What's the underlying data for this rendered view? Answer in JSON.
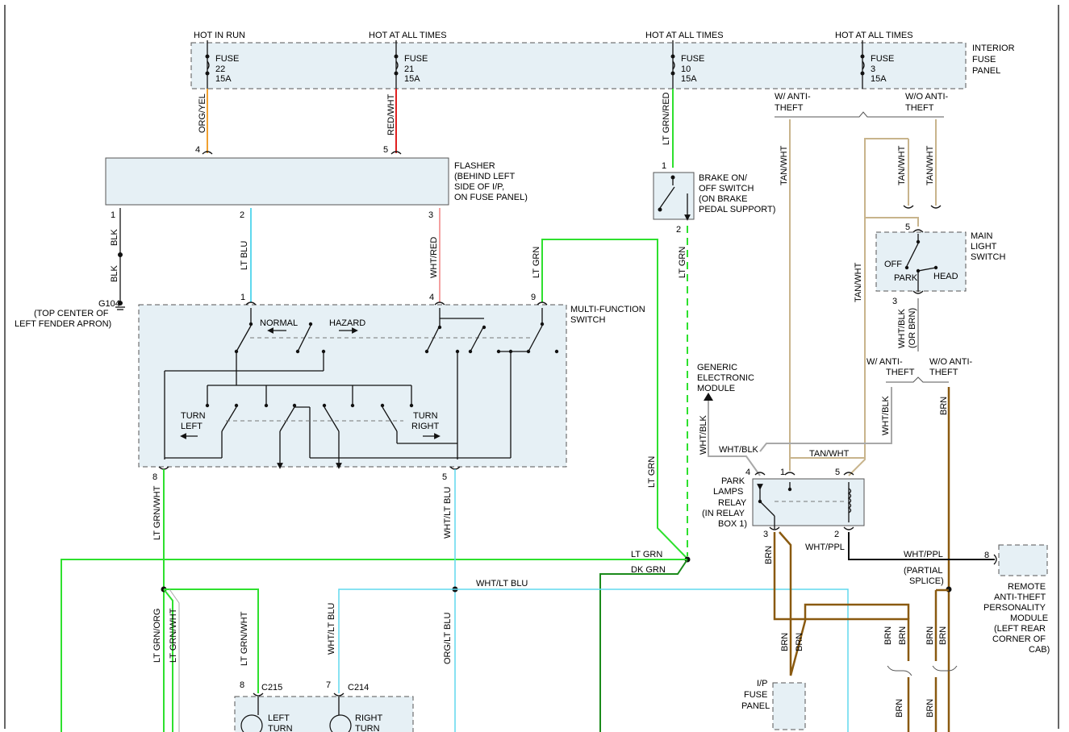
{
  "colors": {
    "org_yel": "#f0a030",
    "red": "#e02020",
    "lt_grn": "#2ee02e",
    "dk_grn": "#1a8a1a",
    "lt_blu": "#60d8ee",
    "tan": "#c8b48c",
    "gray": "#a8a8a8",
    "brn": "#8a5a10",
    "blk": "#111111",
    "panel_fill": "#e6f0f5"
  },
  "fuse_panel": {
    "label_l1": "INTERIOR",
    "label_l2": "FUSE",
    "label_l3": "PANEL",
    "feeds": [
      "HOT IN RUN",
      "HOT AT ALL TIMES",
      "HOT AT ALL TIMES",
      "HOT AT ALL TIMES"
    ],
    "fuses": [
      {
        "name": "FUSE",
        "num": "22",
        "amp": "15A"
      },
      {
        "name": "FUSE",
        "num": "21",
        "amp": "15A"
      },
      {
        "name": "FUSE",
        "num": "10",
        "amp": "15A"
      },
      {
        "name": "FUSE",
        "num": "3",
        "amp": "15A"
      }
    ]
  },
  "flasher": {
    "label_l1": "FLASHER",
    "label_l2": "(BEHIND LEFT",
    "label_l3": "SIDE OF I/P,",
    "label_l4": "ON FUSE PANEL)",
    "pins": [
      "4",
      "5",
      "1",
      "2",
      "3"
    ]
  },
  "ground": {
    "label_l1": "G104",
    "label_l2": "(TOP CENTER OF",
    "label_l3": "LEFT FENDER APRON)"
  },
  "brake_switch": {
    "label_l1": "BRAKE ON/",
    "label_l2": "OFF SWITCH",
    "label_l3": "(ON BRAKE",
    "label_l4": "PEDAL SUPPORT)",
    "pins": [
      "1",
      "2"
    ]
  },
  "multifunction": {
    "label_l1": "MULTI-FUNCTION",
    "label_l2": "SWITCH",
    "normal": "NORMAL",
    "hazard": "HAZARD",
    "turn_left_l1": "TURN",
    "turn_left_l2": "LEFT",
    "turn_right_l1": "TURN",
    "turn_right_l2": "RIGHT",
    "pins": [
      "1",
      "4",
      "9",
      "8",
      "5"
    ]
  },
  "main_light_switch": {
    "label_l1": "MAIN",
    "label_l2": "LIGHT",
    "label_l3": "SWITCH",
    "off": "OFF",
    "park": "PARK",
    "head": "HEAD",
    "pins": [
      "5",
      "3"
    ]
  },
  "generic_module": {
    "label_l1": "GENERIC",
    "label_l2": "ELECTRONIC",
    "label_l3": "MODULE"
  },
  "relay": {
    "label_l1": "PARK",
    "label_l2": "LAMPS",
    "label_l3": "RELAY",
    "label_l4": "(IN RELAY",
    "label_l5": "BOX 1)",
    "pins": [
      "4",
      "1",
      "5",
      "3",
      "2"
    ]
  },
  "anti_theft_module": {
    "label_l1": "REMOTE",
    "label_l2": "ANTI-THEFT",
    "label_l3": "PERSONALITY",
    "label_l4": "MODULE",
    "label_l5": "(LEFT REAR",
    "label_l6": "CORNER OF",
    "label_l7": "CAB)",
    "pin": "8"
  },
  "ip_fuse_panel": {
    "label_l1": "I/P",
    "label_l2": "FUSE",
    "label_l3": "PANEL"
  },
  "partial_splice": {
    "label_l1": "(PARTIAL",
    "label_l2": "SPLICE)"
  },
  "options": {
    "w_anti_l1": "W/ ANTI-",
    "w_anti_l2": "THEFT",
    "wo_anti_l1": "W/O ANTI-",
    "wo_anti_l2": "THEFT"
  },
  "connectors": {
    "c215": "C215",
    "c215_pin": "8",
    "c214": "C214",
    "c214_pin": "7"
  },
  "lamps": {
    "left_l1": "LEFT",
    "left_l2": "TURN",
    "right_l1": "RIGHT",
    "right_l2": "TURN"
  },
  "wires": {
    "org_yel": "ORG/YEL",
    "red_wht": "RED/WHT",
    "lt_grn_red": "LT GRN/RED",
    "blk": "BLK",
    "lt_blu": "LT BLU",
    "wht_red": "WHT/RED",
    "lt_grn": "LT GRN",
    "dk_grn": "DK GRN",
    "lt_grn_wht": "LT GRN/WHT",
    "wht_lt_blu": "WHT/LT BLU",
    "lt_grn_org": "LT GRN/ORG",
    "org_lt_blu": "ORG/LT BLU",
    "tan_wht": "TAN/WHT",
    "wht_blk": "WHT/BLK",
    "wht_blk_or_brn_l1": "WHT/BLK",
    "wht_blk_or_brn_l2": "(OR BRN)",
    "brn": "BRN",
    "wht_ppl": "WHT/PPL"
  }
}
